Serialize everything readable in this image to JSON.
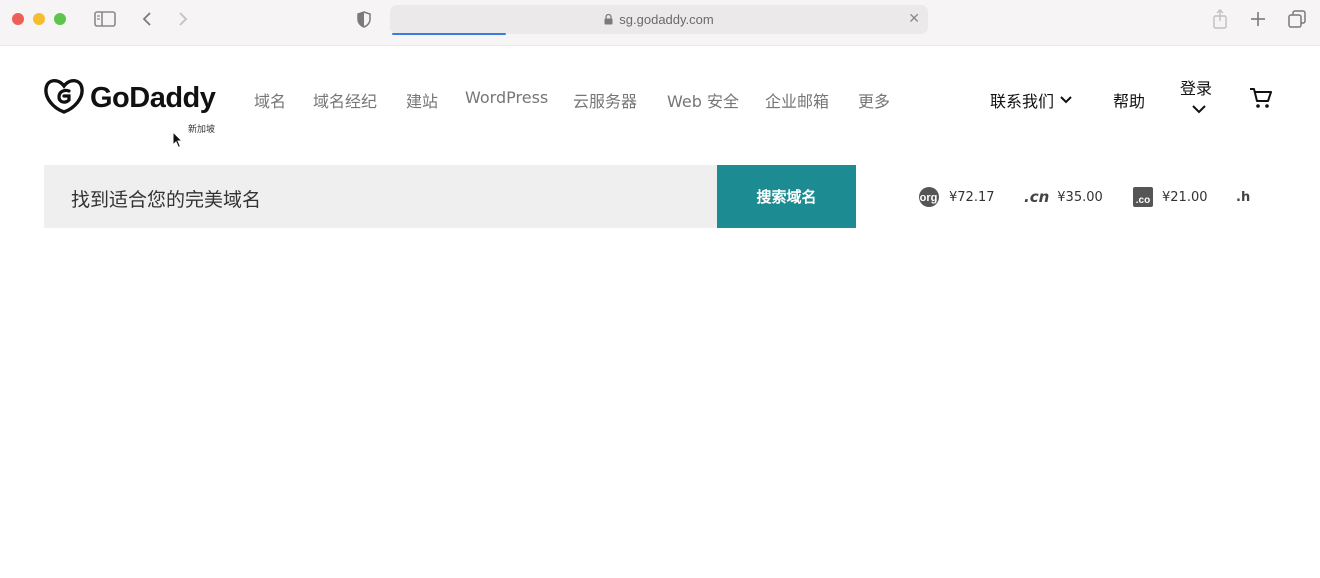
{
  "browser": {
    "url": "sg.godaddy.com",
    "close_glyph": "✕"
  },
  "header": {
    "brand": "GoDaddy",
    "region": "新加坡",
    "nav": [
      "域名",
      "域名经纪",
      "建站",
      "WordPress",
      "云服务器",
      "Web 安全",
      "企业邮箱",
      "更多"
    ],
    "contact_label": "联系我们",
    "help_label": "帮助",
    "login_label": "登录"
  },
  "search": {
    "placeholder": "找到适合您的完美域名",
    "button_label": "搜索域名"
  },
  "tld_offers": [
    {
      "tld": ".org",
      "price": "¥72.17"
    },
    {
      "tld": ".cn",
      "price": "¥35.00"
    },
    {
      "tld": ".co",
      "price": "¥21.00"
    },
    {
      "tld": ".h",
      "price": ""
    }
  ],
  "colors": {
    "accent": "#1c8c92",
    "search_bg": "#efefef"
  }
}
